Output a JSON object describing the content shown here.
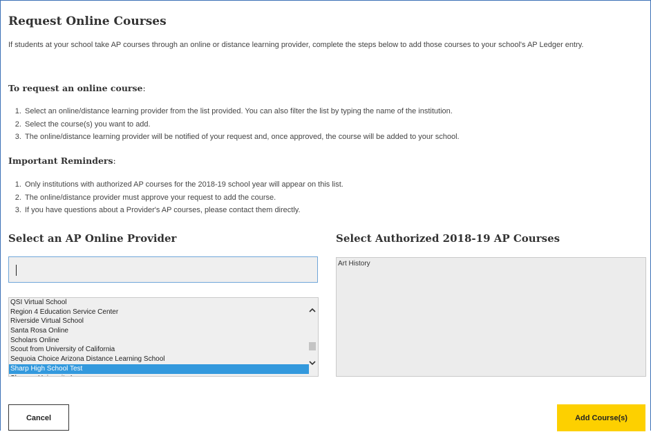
{
  "page": {
    "title": "Request Online Courses",
    "intro": "If students at your school take AP courses through an online or distance learning provider, complete the steps below to add those courses to your school's AP Ledger entry."
  },
  "request_section": {
    "heading": "To request an online course",
    "steps": [
      "Select an online/distance learning provider from the list provided. You can also filter the list by typing the name of the institution.",
      "Select the course(s) you want to add.",
      "The online/distance learning provider will be notified of your request and, once approved, the course will be added to your school."
    ]
  },
  "reminders_section": {
    "heading": "Important Reminders",
    "items": [
      "Only institutions with authorized AP courses for the 2018-19 school year will appear on this list.",
      "The online/distance provider must approve your request to add the course.",
      "If you have questions about a Provider's AP courses, please contact them directly."
    ]
  },
  "provider_panel": {
    "title": "Select an AP Online Provider",
    "search_value": "",
    "items": [
      "QSI Virtual School",
      "Region 4 Education Service Center",
      "Riverside Virtual School",
      "Santa Rosa Online",
      "Scholars Online",
      "Scout from University of California",
      "Sequoia Choice Arizona Distance Learning School",
      "Sharp High School Test",
      "Shmoop University Inc"
    ],
    "selected": "Sharp High School Test"
  },
  "course_panel": {
    "title": "Select Authorized 2018-19 AP Courses",
    "items": [
      "Art History"
    ]
  },
  "buttons": {
    "cancel": "Cancel",
    "add": "Add Course(s)"
  },
  "colors": {
    "border_accent": "#3b6fb6",
    "selected_row": "#3399dd",
    "primary_button": "#fdd000"
  },
  "icons": {
    "scroll_up": "chevron-up-icon",
    "scroll_down": "chevron-down-icon"
  }
}
